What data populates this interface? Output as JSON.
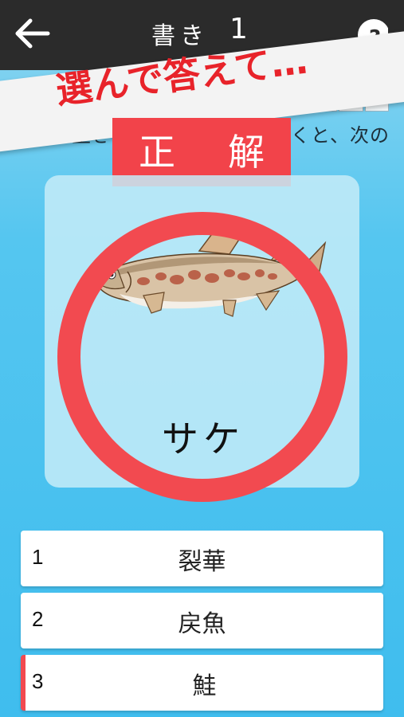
{
  "header": {
    "title": "書き",
    "number": "1",
    "back_icon": "back-arrow-icon",
    "help_icon": "help-icon"
  },
  "banner": {
    "text": "選んで答えて…"
  },
  "question": {
    "text": "この字の生き物の絵をよく見て書くと、次の"
  },
  "result": {
    "label_left": "正",
    "label_right": "解"
  },
  "card": {
    "image": "salmon-illustration",
    "word": "サケ"
  },
  "choices": [
    {
      "number": "1",
      "text": "裂華",
      "selected": false
    },
    {
      "number": "2",
      "text": "戻魚",
      "selected": false
    },
    {
      "number": "3",
      "text": "鮭",
      "selected": true
    }
  ],
  "colors": {
    "accent_red": "#f24a50",
    "topbar": "#2b2b2b",
    "background": "#4cc2ee"
  }
}
